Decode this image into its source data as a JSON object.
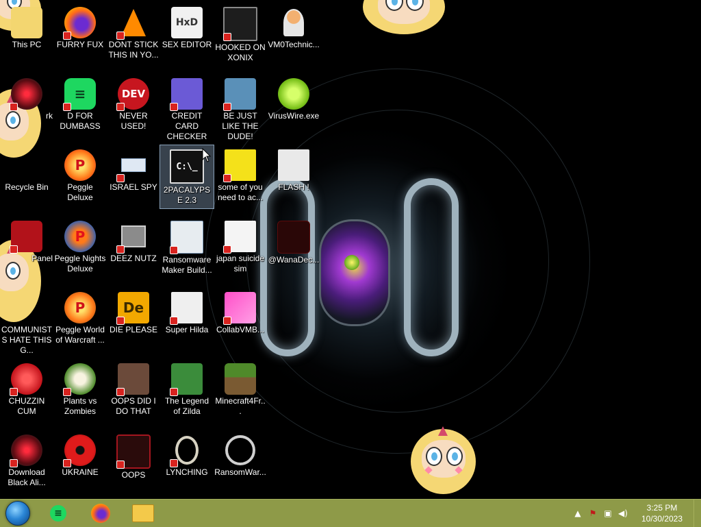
{
  "desktop": {
    "icons": [
      {
        "label": "This PC"
      },
      {
        "label": "FURRY FUX"
      },
      {
        "label": "DONT STICK THIS IN YO..."
      },
      {
        "label": "SEX EDITOR"
      },
      {
        "label": "HOOKED ON XONIX"
      },
      {
        "label": "VM0Technic..."
      },
      {
        "label": "rk"
      },
      {
        "label": "D FOR DUMBASS"
      },
      {
        "label": "NEVER USED!"
      },
      {
        "label": "CREDIT CARD CHECKER"
      },
      {
        "label": "BE JUST LIKE THE DUDE!"
      },
      {
        "label": "VirusWire.exe"
      },
      {
        "label": "Recycle Bin"
      },
      {
        "label": "Peggle Deluxe"
      },
      {
        "label": "ISRAEL SPY"
      },
      {
        "label": "2PACALYPSE 2.3"
      },
      {
        "label": "some of you need to ac..."
      },
      {
        "label": "FLASH !"
      },
      {
        "label": "Panel"
      },
      {
        "label": "Peggle Nights Deluxe"
      },
      {
        "label": "DEEZ NUTZ"
      },
      {
        "label": "Ransomware Maker Build..."
      },
      {
        "label": "japan suicide sim"
      },
      {
        "label": "@WanaDec..."
      },
      {
        "label": "COMMUNISTS HATE THIS G..."
      },
      {
        "label": "Peggle World of Warcraft ..."
      },
      {
        "label": "DIE PLEASE"
      },
      {
        "label": "Super Hilda"
      },
      {
        "label": "CollabVMB..."
      },
      {
        "label": "CHUZZIN CUM"
      },
      {
        "label": "Plants vs Zombies"
      },
      {
        "label": "OOPS DID I DO THAT"
      },
      {
        "label": "The Legend of Zilda"
      },
      {
        "label": "Minecraft4Fr..."
      },
      {
        "label": "Download Black Ali..."
      },
      {
        "label": "UKRAINE"
      },
      {
        "label": "OOPS"
      },
      {
        "label": "LYNCHING"
      },
      {
        "label": "RansomWar..."
      }
    ],
    "icon_glyphs": {
      "dev": "DEV",
      "cmd": "C:\\_",
      "de": "De",
      "p": "P"
    }
  },
  "taskbar": {
    "clock_time": "3:25 PM",
    "clock_date": "10/30/2023",
    "tray_chevron": "▲",
    "tray_flag": "⚑",
    "tray_network": "▣",
    "tray_volume": "◀)"
  },
  "colors": {
    "taskbar": "#8e9a48",
    "selection": "#a0bedc"
  }
}
